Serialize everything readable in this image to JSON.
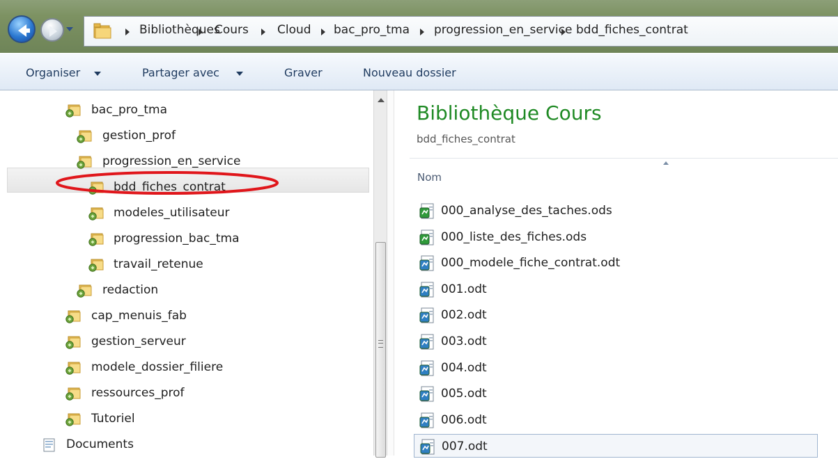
{
  "breadcrumb": [
    "Bibliothèques",
    "Cours",
    "Cloud",
    "bac_pro_tma",
    "progression_en_service",
    "bdd_fiches_contrat"
  ],
  "toolbar": {
    "organize": "Organiser",
    "share": "Partager avec",
    "burn": "Graver",
    "new_folder": "Nouveau dossier"
  },
  "tree": [
    {
      "label": "bac_pro_tma",
      "level": 1,
      "icon": "library-folder-icon"
    },
    {
      "label": "gestion_prof",
      "level": 2,
      "icon": "library-folder-icon"
    },
    {
      "label": "progression_en_service",
      "level": 2,
      "icon": "library-folder-icon"
    },
    {
      "label": "bdd_fiches_contrat",
      "level": 3,
      "icon": "library-folder-icon",
      "selected": true,
      "highlighted": true
    },
    {
      "label": "modeles_utilisateur",
      "level": 3,
      "icon": "library-folder-icon"
    },
    {
      "label": "progression_bac_tma",
      "level": 3,
      "icon": "library-folder-icon"
    },
    {
      "label": "travail_retenue",
      "level": 3,
      "icon": "library-folder-icon"
    },
    {
      "label": "redaction",
      "level": 2,
      "icon": "library-folder-icon"
    },
    {
      "label": "cap_menuis_fab",
      "level": 1,
      "icon": "library-folder-icon"
    },
    {
      "label": "gestion_serveur",
      "level": 1,
      "icon": "library-folder-icon"
    },
    {
      "label": "modele_dossier_filiere",
      "level": 1,
      "icon": "library-folder-icon"
    },
    {
      "label": "ressources_prof",
      "level": 1,
      "icon": "library-folder-icon"
    },
    {
      "label": "Tutoriel",
      "level": 1,
      "icon": "library-folder-icon"
    },
    {
      "label": "Documents",
      "level": 0,
      "icon": "documents-library-icon"
    }
  ],
  "library": {
    "title": "Bibliothèque Cours",
    "subtitle": "bdd_fiches_contrat"
  },
  "columns": {
    "name": "Nom"
  },
  "files": [
    {
      "name": "000_analyse_des_taches.ods",
      "icon": "spreadsheet-file-icon"
    },
    {
      "name": "000_liste_des_fiches.ods",
      "icon": "spreadsheet-file-icon"
    },
    {
      "name": "000_modele_fiche_contrat.odt",
      "icon": "text-document-file-icon"
    },
    {
      "name": "001.odt",
      "icon": "text-document-file-icon"
    },
    {
      "name": "002.odt",
      "icon": "text-document-file-icon"
    },
    {
      "name": "003.odt",
      "icon": "text-document-file-icon"
    },
    {
      "name": "004.odt",
      "icon": "text-document-file-icon"
    },
    {
      "name": "005.odt",
      "icon": "text-document-file-icon"
    },
    {
      "name": "006.odt",
      "icon": "text-document-file-icon"
    },
    {
      "name": "007.odt",
      "icon": "text-document-file-icon",
      "focused": true
    }
  ],
  "colors": {
    "library_title": "#1f8a24",
    "highlight_ellipse": "#e0161b",
    "toolbar_text": "#1e3a5f"
  }
}
